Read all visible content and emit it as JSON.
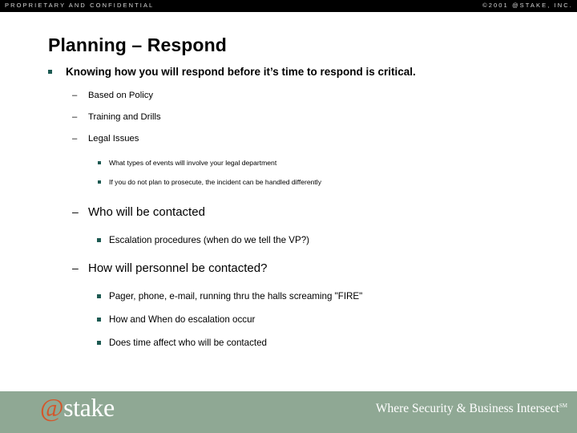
{
  "header": {
    "left_text": "PROPRIETARY AND CONFIDENTIAL",
    "right_text": "©2001 @STAKE, INC.",
    "background_color": "#000000",
    "text_color": "#d8d8d8"
  },
  "slide": {
    "title": "Planning – Respond",
    "bullet_color": "#1d5a52",
    "body": [
      {
        "level": 1,
        "marker": "square",
        "text": "Knowing how you will respond before it’s time to respond is critical."
      },
      {
        "level": 2,
        "marker": "dash",
        "text": "Based on Policy"
      },
      {
        "level": 2,
        "marker": "dash",
        "text": "Training and Drills"
      },
      {
        "level": 2,
        "marker": "dash",
        "text": "Legal Issues"
      },
      {
        "level": 3,
        "marker": "square",
        "text": "What types of events will involve your legal department"
      },
      {
        "level": 3,
        "marker": "square",
        "text": "If you do not plan to prosecute, the incident can be handled differently"
      },
      {
        "level": 2,
        "marker": "dash",
        "text": "Who will be contacted"
      },
      {
        "level": 3,
        "marker": "square",
        "text": "Escalation procedures (when do we tell the VP?)"
      },
      {
        "level": 2,
        "marker": "dash",
        "text": "How will personnel be contacted?"
      },
      {
        "level": 3,
        "marker": "square",
        "text": "Pager, phone, e-mail, running thru the halls screaming \"FIRE\""
      },
      {
        "level": 3,
        "marker": "square",
        "text": "How and When do escalation occur"
      },
      {
        "level": 3,
        "marker": "square",
        "text": "Does time affect who will be contacted"
      }
    ],
    "dash_marker": "–"
  },
  "footer": {
    "background_color": "#8fa894",
    "logo_at": "@",
    "logo_name": "stake",
    "logo_at_color": "#d4562a",
    "tagline": "Where Security & Business Intersect",
    "tagline_mark": "SM"
  }
}
